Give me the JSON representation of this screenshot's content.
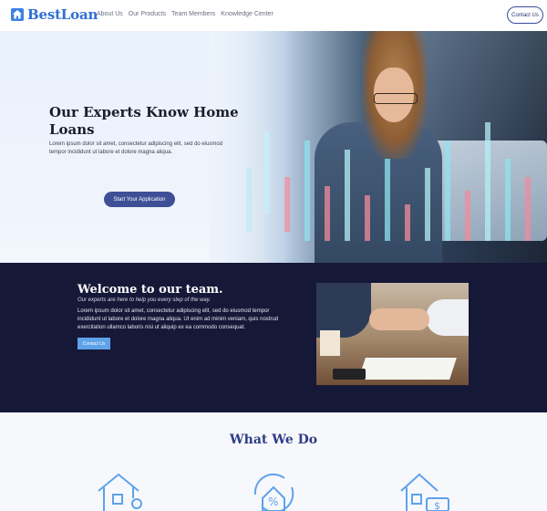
{
  "brand": {
    "name": "BestLoan",
    "color": "#2f6fd6"
  },
  "nav": [
    "About Us",
    "Our Products",
    "Team Members",
    "Knowledge Center"
  ],
  "header": {
    "contact_label": "Contact Us"
  },
  "hero": {
    "title": "Our Experts Know Home Loans",
    "text": "Lorem ipsum dolor sit amet, consectetur adipiscing elit, sed do eiusmod tempor incididunt ut labore et dolore magna aliqua.",
    "cta": "Start Your Application"
  },
  "welcome": {
    "title": "Welcome to our team.",
    "subtitle": "Our experts are here to help you every step of the way.",
    "text": "Lorem ipsum dolor sit amet, consectetur adipiscing elit, sed do eiusmod tempor incididunt ut labore et dolore magna aliqua. Ut enim ad minim veniam, quis nostrud exercitation ullamco laboris nisi ut aliquip ex ea commodo consequat.",
    "button": "Contact Us"
  },
  "whatwedo": {
    "title": "What We Do",
    "icons": [
      "house-search-icon",
      "house-percent-refresh-icon",
      "house-money-icon"
    ]
  },
  "colors": {
    "navy": "#161838",
    "accent": "#3e4f96",
    "light_blue": "#5ea2ea"
  }
}
